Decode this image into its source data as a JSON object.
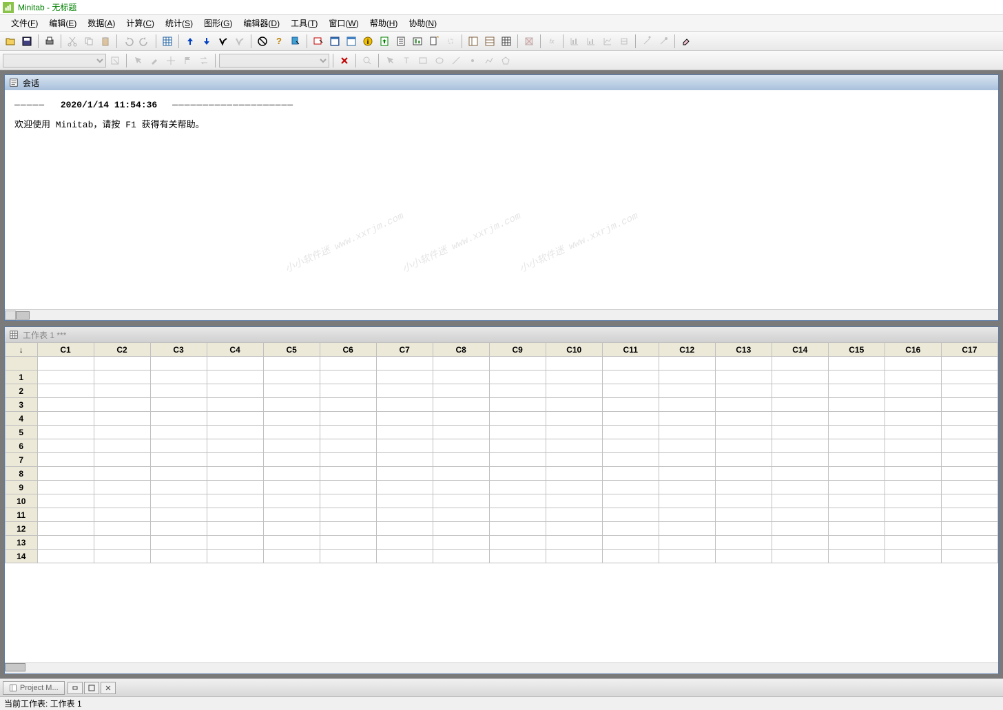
{
  "app": {
    "name": "Minitab",
    "doc_title": "无标题"
  },
  "menu": [
    {
      "label": "文件",
      "accel": "F"
    },
    {
      "label": "编辑",
      "accel": "E"
    },
    {
      "label": "数据",
      "accel": "A"
    },
    {
      "label": "计算",
      "accel": "C"
    },
    {
      "label": "统计",
      "accel": "S"
    },
    {
      "label": "图形",
      "accel": "G"
    },
    {
      "label": "编辑器",
      "accel": "D"
    },
    {
      "label": "工具",
      "accel": "T"
    },
    {
      "label": "窗口",
      "accel": "W"
    },
    {
      "label": "帮助",
      "accel": "H"
    },
    {
      "label": "协助",
      "accel": "N"
    }
  ],
  "session": {
    "title": "会话",
    "timestamp": "2020/1/14 11:54:36",
    "welcome": "欢迎使用 Minitab，请按 F1 获得有关帮助。"
  },
  "worksheet": {
    "title": "工作表 1 ***",
    "columns": [
      "C1",
      "C2",
      "C3",
      "C4",
      "C5",
      "C6",
      "C7",
      "C8",
      "C9",
      "C10",
      "C11",
      "C12",
      "C13",
      "C14",
      "C15",
      "C16",
      "C17"
    ],
    "rows": [
      1,
      2,
      3,
      4,
      5,
      6,
      7,
      8,
      9,
      10,
      11,
      12,
      13,
      14
    ]
  },
  "taskbar": {
    "project_label": "Project M..."
  },
  "status": {
    "text": "当前工作表: 工作表 1"
  },
  "watermark": "www.xxrjm.com",
  "watermark_prefix": "小小软件迷 "
}
